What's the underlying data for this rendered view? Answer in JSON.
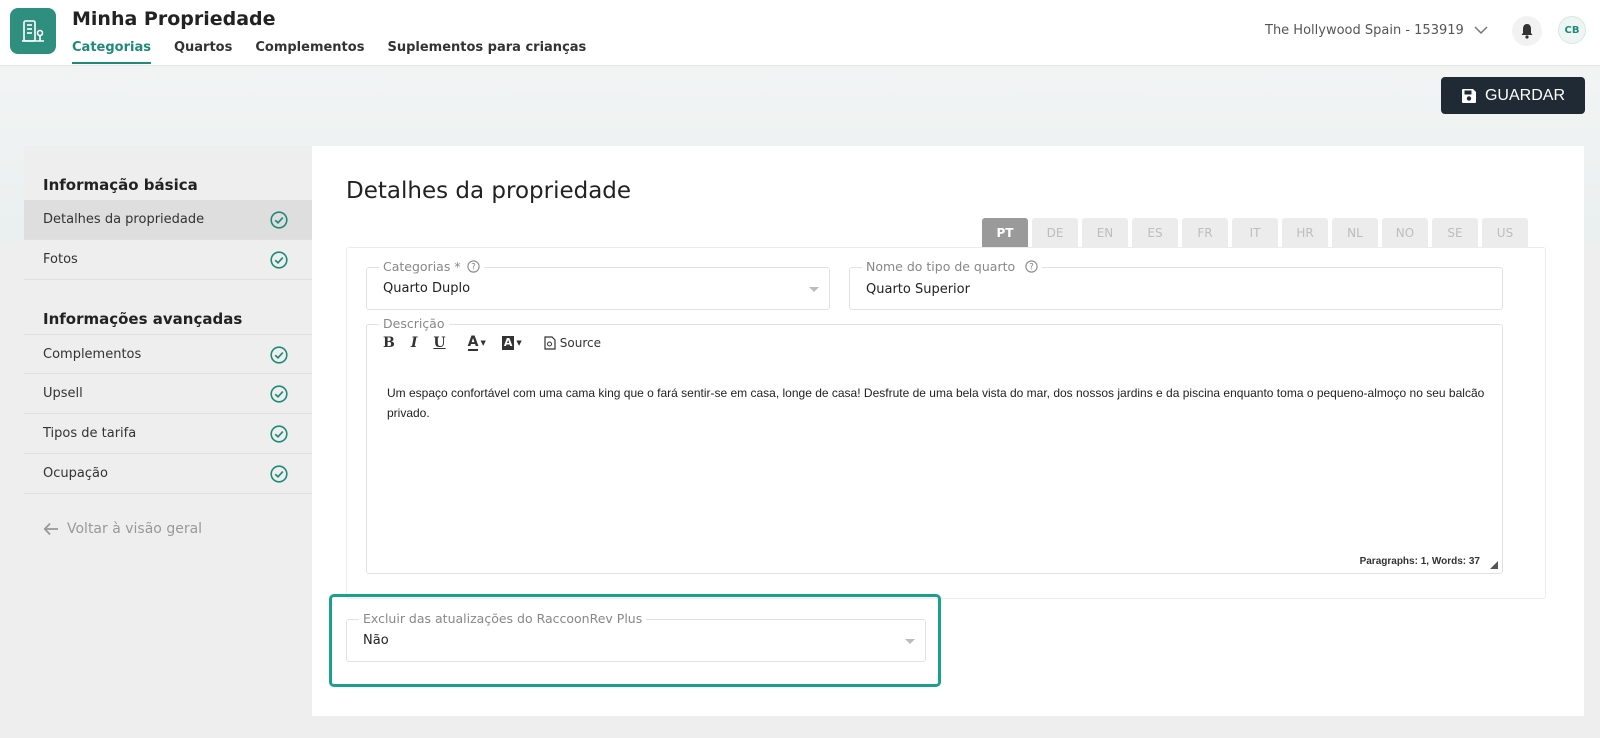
{
  "app": {
    "title": "Minha Propriedade",
    "logo_icon": "building-icon"
  },
  "tabs": [
    {
      "label": "Categorias",
      "active": true
    },
    {
      "label": "Quartos",
      "active": false
    },
    {
      "label": "Complementos",
      "active": false
    },
    {
      "label": "Suplementos para crianças",
      "active": false
    }
  ],
  "header": {
    "property_selector": "The Hollywood Spain - 153919",
    "avatar_initials": "CB"
  },
  "toolbar": {
    "save_label": "GUARDAR"
  },
  "sidebar": {
    "basic_title": "Informação básica",
    "advanced_title": "Informações avançadas",
    "basic_items": [
      {
        "label": "Detalhes da propriedade",
        "active": true,
        "complete": true
      },
      {
        "label": "Fotos",
        "active": false,
        "complete": true
      }
    ],
    "advanced_items": [
      {
        "label": "Complementos",
        "complete": true
      },
      {
        "label": "Upsell",
        "complete": true
      },
      {
        "label": "Tipos de tarifa",
        "complete": true
      },
      {
        "label": "Ocupação",
        "complete": true
      }
    ],
    "back_label": "Voltar à visão geral"
  },
  "main": {
    "title": "Detalhes da propriedade",
    "languages": [
      {
        "code": "PT",
        "active": true
      },
      {
        "code": "DE",
        "active": false
      },
      {
        "code": "EN",
        "active": false
      },
      {
        "code": "ES",
        "active": false
      },
      {
        "code": "FR",
        "active": false
      },
      {
        "code": "IT",
        "active": false
      },
      {
        "code": "HR",
        "active": false
      },
      {
        "code": "NL",
        "active": false
      },
      {
        "code": "NO",
        "active": false
      },
      {
        "code": "SE",
        "active": false
      },
      {
        "code": "US",
        "active": false
      }
    ],
    "category": {
      "label": "Categorias *",
      "value": "Quarto Duplo"
    },
    "room_type_name": {
      "label": "Nome do tipo de quarto",
      "value": "Quarto Superior"
    },
    "description": {
      "label": "Descrição",
      "toolbar": {
        "bold": "B",
        "italic": "I",
        "underline": "U",
        "text_color": "A",
        "bg_color": "A",
        "source": "Source"
      },
      "text": "Um espaço confortável com uma cama king que o fará sentir-se em casa, longe de casa! Desfrute de uma bela vista do mar, dos nossos jardins e da piscina enquanto toma o pequeno-almoço no seu balcão privado.",
      "word_count": "Paragraphs: 1, Words: 37"
    },
    "exclude_updates": {
      "label": "Excluir das atualizações do RaccoonRev Plus",
      "value": "Não"
    }
  },
  "colors": {
    "accent": "#1f8a78",
    "highlight": "#1aa08b",
    "save_button": "#1f2a35"
  }
}
